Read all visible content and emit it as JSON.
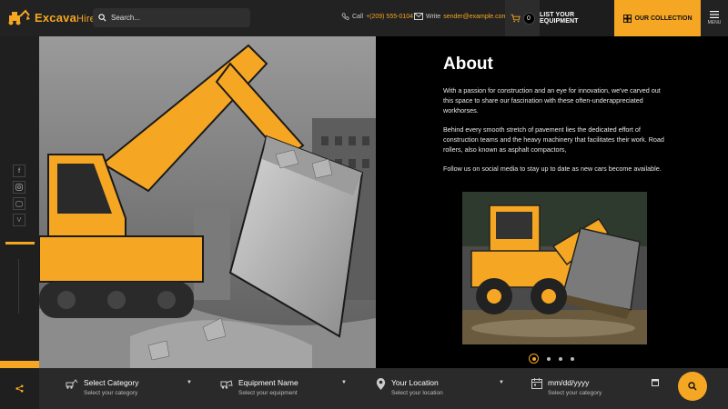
{
  "header": {
    "logo_main": "Excava",
    "logo_sub": "Hire",
    "search_placeholder": "Search...",
    "phone_label": "Call",
    "phone_number": "+(209) 555-0104",
    "email_label": "Write",
    "email_address": "sender@example.com",
    "cart_count": "0",
    "list_equipment": "LIST YOUR EQUIPMENT",
    "our_collection": "OUR COLLECTION",
    "menu_label": "MENU"
  },
  "colors": {
    "accent": "#f5a623",
    "dark": "#222222",
    "panel": "#000000"
  },
  "about": {
    "title": "About",
    "paragraphs": [
      "With a passion for construction and an eye for innovation, we've carved out this space to share our fascination with these often-underappreciated workhorses.",
      "Behind every smooth stretch of pavement lies the dedicated effort of construction teams and the heavy machinery that facilitates their work. Road rollers, also known as asphalt compactors,",
      "Follow us on social media to stay up to date as new cars become available."
    ]
  },
  "search_bar": {
    "category": {
      "title": "Select Category",
      "subtitle": "Select your category"
    },
    "equipment": {
      "title": "Equipment Name",
      "subtitle": "Select your equipment"
    },
    "location": {
      "title": "Your Location",
      "subtitle": "Select your location"
    },
    "date": {
      "title": "mm/dd/yyyy",
      "subtitle": "Select your category"
    }
  },
  "social_icons": [
    "facebook-icon",
    "instagram-icon",
    "discord-icon",
    "vimeo-icon"
  ]
}
